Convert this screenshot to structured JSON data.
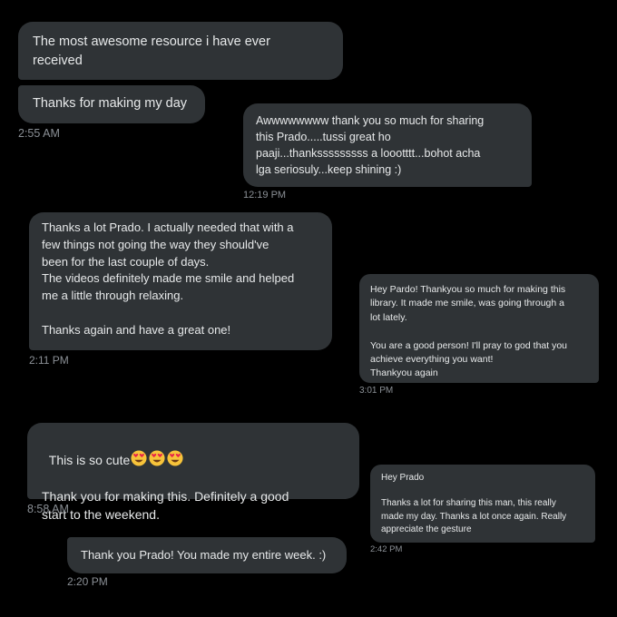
{
  "messages": [
    {
      "text": "The most awesome resource i have ever\nreceived",
      "time": ""
    },
    {
      "text": "Thanks for making my day",
      "time": "2:55 AM"
    },
    {
      "text": "Awwwwwwww thank you so much for sharing\nthis Prado.....tussi great ho\npaaji...thanksssssssss a loootttt...bohot acha\nlga seriosuly...keep shining :)",
      "time": "12:19 PM"
    },
    {
      "text": "Thanks a lot Prado. I actually needed that with a\nfew things not going the way they should've\nbeen for the last couple of days.\nThe videos definitely made me smile and helped\nme a little through relaxing.\n\nThanks again and have a great one!",
      "time": "2:11 PM"
    },
    {
      "text": "Hey Pardo! Thankyou so much for making this\nlibrary. It made me smile, was going through a\nlot lately.\n\nYou are a good person! I'll pray to god that you\nachieve everything you want!\nThankyou again",
      "time": "3:01 PM"
    },
    {
      "text_prefix": "This is so cute",
      "emoji_name": "heart-eyes-emoji",
      "emoji_count": 3,
      "text_rest": "Thank you for making this. Definitely a good\nstart to the weekend.",
      "time": "8:58 AM"
    },
    {
      "text": "Hey Prado\n\nThanks a lot for sharing this man, this really\nmade my day. Thanks a lot once again. Really\nappreciate the gesture",
      "time": "2:42 PM"
    },
    {
      "text": "Thank you Prado! You made my entire week. :)",
      "time": "2:20 PM"
    }
  ],
  "colors": {
    "background": "#000000",
    "bubble": "#2f3336",
    "text": "#e7e9ea",
    "timestamp": "#8b9096",
    "emoji_face": "#f7c33a",
    "emoji_heart": "#e8244a"
  }
}
